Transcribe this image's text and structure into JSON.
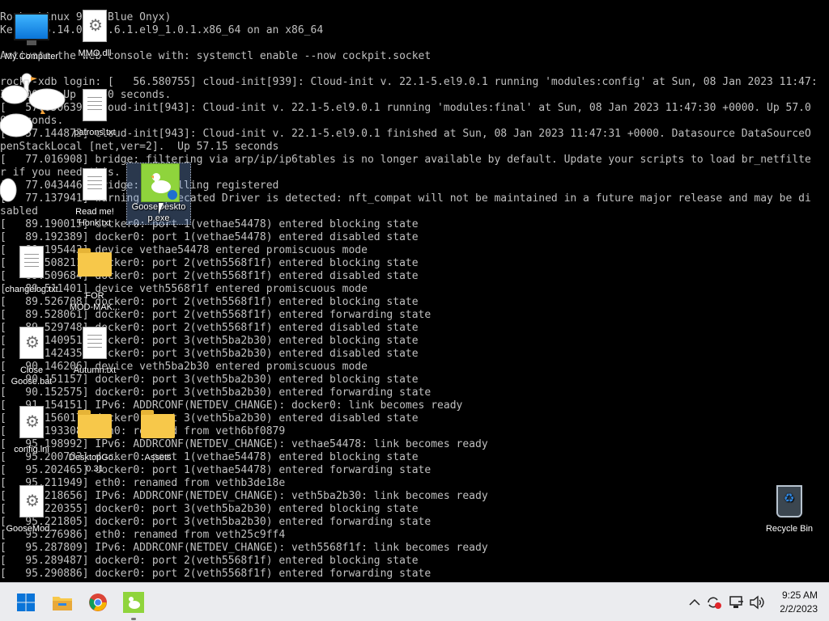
{
  "console": {
    "lines": [
      "Rocky Linux 9.1 (Blue Onyx)",
      "Kernel 5.14.0-162.6.1.el9_1.0.1.x86_64 on an x86_64",
      "",
      "Activate the web console with: systemctl enable --now cockpit.socket",
      "",
      "rocky-xdb login: [   56.580755] cloud-init[939]: Cloud-init v. 22.1-5.el9.0.1 running 'modules:config' at Sun, 08 Jan 2023 11:47:",
      "30 +0000. Up 56.60 seconds.",
      "[   57.050639] cloud-init[943]: Cloud-init v. 22.1-5.el9.0.1 running 'modules:final' at Sun, 08 Jan 2023 11:47:30 +0000. Up 57.0",
      "0 seconds.",
      "[   57.144873] cloud-init[943]: Cloud-init v. 22.1-5.el9.0.1 finished at Sun, 08 Jan 2023 11:47:31 +0000. Datasource DataSourceO",
      "penStackLocal [net,ver=2].  Up 57.15 seconds",
      "[   77.016908] bridge: filtering via arp/ip/ip6tables is no longer available by default. Update your scripts to load br_netfilte",
      "r if you need this.",
      "[   77.043446] bridge: installing registered",
      "[   77.137941] warning: Deprecated Driver is detected: nft_compat will not be maintained in a future major release and may be di",
      "sabled",
      "[   89.190015] docker0: port 1(vethae54478) entered blocking state",
      "[   89.192389] docker0: port 1(vethae54478) entered disabled state",
      "[   89.195443] device vethae54478 entered promiscuous mode",
      "[   89.508211] docker0: port 2(veth5568f1f) entered blocking state",
      "[   89.509684] docker0: port 2(veth5568f1f) entered disabled state",
      "[   89.511401] device veth5568f1f entered promiscuous mode",
      "[   89.526708] docker0: port 2(veth5568f1f) entered blocking state",
      "[   89.528061] docker0: port 2(veth5568f1f) entered forwarding state",
      "[   89.529748] docker0: port 2(veth5568f1f) entered disabled state",
      "[   90.140951] docker0: port 3(veth5ba2b30) entered blocking state",
      "[   90.142435] docker0: port 3(veth5ba2b30) entered disabled state",
      "[   90.146206] device veth5ba2b30 entered promiscuous mode",
      "[   90.151157] docker0: port 3(veth5ba2b30) entered blocking state",
      "[   90.152575] docker0: port 3(veth5ba2b30) entered forwarding state",
      "[   91.154151] IPv6: ADDRCONF(NETDEV_CHANGE): docker0: link becomes ready",
      "[   91.156017] docker0: port 3(veth5ba2b30) entered disabled state",
      "[   95.193308] eth0: renamed from veth6bf0879",
      "[   95.198992] IPv6: ADDRCONF(NETDEV_CHANGE): vethae54478: link becomes ready",
      "[   95.200703] docker0: port 1(vethae54478) entered blocking state",
      "[   95.202465] docker0: port 1(vethae54478) entered forwarding state",
      "[   95.211949] eth0: renamed from vethb3de18e",
      "[   95.218656] IPv6: ADDRCONF(NETDEV_CHANGE): veth5ba2b30: link becomes ready",
      "[   95.220355] docker0: port 3(veth5ba2b30) entered blocking state",
      "[   95.221805] docker0: port 3(veth5ba2b30) entered forwarding state",
      "[   95.276986] eth0: renamed from veth25c9ff4",
      "[   95.287809] IPv6: ADDRCONF(NETDEV_CHANGE): veth5568f1f: link becomes ready",
      "[   95.289487] docker0: port 2(veth5568f1f) entered blocking state",
      "[   95.290886] docker0: port 2(veth5568f1f) entered forwarding state"
    ]
  },
  "desktop": {
    "icons": [
      {
        "name": "my-computer",
        "label": "My Computer",
        "icon": "monitor-icon"
      },
      {
        "name": "mmo-dll",
        "label": "MMO.dll",
        "icon": "gear-file-icon"
      },
      {
        "name": "patrons-txt",
        "label": "patrons.txt",
        "icon": "text-file-icon"
      },
      {
        "name": "read-me",
        "label": "Read me!",
        "label2": "Honk.txt",
        "icon": "text-file-icon"
      },
      {
        "name": "goose-desktop",
        "label": "GooseDeskto",
        "label2": "p.exe",
        "icon": "goose-app-icon"
      },
      {
        "name": "changelog",
        "label": "changelog.txt",
        "icon": "text-file-icon"
      },
      {
        "name": "mod-folder",
        "label": "FOR",
        "label2": "MOD-MAK...",
        "icon": "folder-icon"
      },
      {
        "name": "close-goose",
        "label": "Close",
        "label2": "Goose.bat",
        "icon": "gear-file-icon"
      },
      {
        "name": "autumn-txt",
        "label": "Autumn.txt",
        "icon": "text-file-icon"
      },
      {
        "name": "config-ini",
        "label": "config.ini",
        "icon": "gear-file-icon"
      },
      {
        "name": "desktop-go-folder",
        "label": "DesktopGo...",
        "label2": "0.31",
        "icon": "folder-icon"
      },
      {
        "name": "assets-folder",
        "label": "Assets",
        "icon": "folder-icon"
      },
      {
        "name": "goose-mod",
        "label": "GooseMod...",
        "icon": "gear-file-icon"
      },
      {
        "name": "recycle-bin",
        "label": "Recycle Bin",
        "icon": "recycle-bin-icon"
      }
    ]
  },
  "taskbar": {
    "apps": [
      {
        "name": "start-button",
        "icon": "windows-logo-icon"
      },
      {
        "name": "file-explorer",
        "icon": "folder-icon"
      },
      {
        "name": "chrome",
        "icon": "chrome-icon"
      },
      {
        "name": "desktop-goose",
        "icon": "goose-app-icon"
      }
    ],
    "tray": [
      "chevron-up-icon",
      "sync-alert-icon",
      "network-icon",
      "volume-icon"
    ],
    "clock": {
      "time": "9:25 AM",
      "date": "2/2/2023"
    }
  },
  "colors": {
    "console_bg": "#000000",
    "console_text": "#c0c0c0",
    "taskbar_bg": "#ebecef",
    "folder": "#f7c84a",
    "accent": "#0a74d8"
  }
}
